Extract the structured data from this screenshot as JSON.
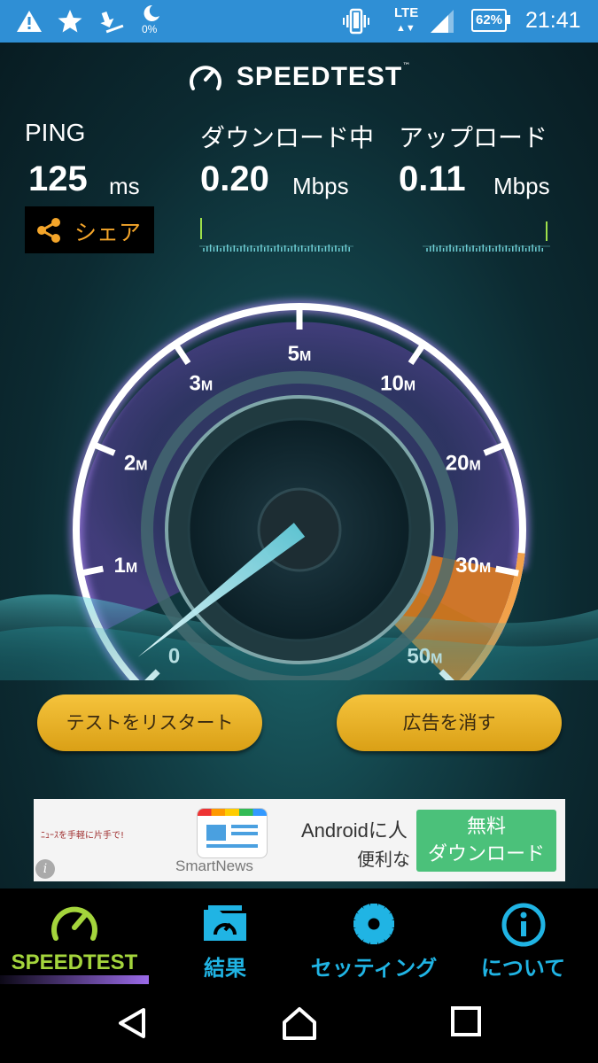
{
  "status_bar": {
    "battery_percent": "62%",
    "network": "LTE",
    "data_percent": "0%",
    "time": "21:41"
  },
  "header": {
    "title": "SPEEDTEST",
    "trademark": "™"
  },
  "ping": {
    "label": "PING",
    "value": "125",
    "unit": "ms"
  },
  "download": {
    "label": "ダウンロード中",
    "value": "0.20",
    "unit": "Mbps"
  },
  "upload": {
    "label": "アップロード",
    "value": "0.11",
    "unit": "Mbps"
  },
  "share_button": {
    "label": "シェア",
    "icon": "share-icon"
  },
  "gauge": {
    "scale_labels": [
      {
        "num": "0",
        "unit": ""
      },
      {
        "num": "1",
        "unit": "M"
      },
      {
        "num": "2",
        "unit": "M"
      },
      {
        "num": "3",
        "unit": "M"
      },
      {
        "num": "5",
        "unit": "M"
      },
      {
        "num": "10",
        "unit": "M"
      },
      {
        "num": "20",
        "unit": "M"
      },
      {
        "num": "30",
        "unit": "M"
      },
      {
        "num": "50",
        "unit": "M"
      }
    ],
    "needle_value_mbps": 0.2,
    "colors": {
      "ring": "#ffffff",
      "glow": "#9b7be0",
      "orange_zone": "#e8801c",
      "needle": "#bff3fb"
    }
  },
  "buttons": {
    "restart": "テストをリスタート",
    "remove_ads": "広告を消す"
  },
  "ad": {
    "left_text": "ﾆｭｰｽを手軽に片手で!",
    "brand": "SmartNews",
    "headline": "Androidに人",
    "subline": "便利な",
    "cta_line1": "無料",
    "cta_line2": "ダウンロード",
    "info_icon": "info-icon"
  },
  "tabs": [
    {
      "label": "SPEEDTEST",
      "icon": "speedometer-icon",
      "color": "#a4d53c",
      "active": true
    },
    {
      "label": "結果",
      "icon": "results-folder-icon",
      "color": "#20b4e4",
      "active": false
    },
    {
      "label": "セッティング",
      "icon": "gear-icon",
      "color": "#20b4e4",
      "active": false
    },
    {
      "label": "について",
      "icon": "info-icon",
      "color": "#20b4e4",
      "active": false
    }
  ],
  "nav": {
    "back": "back-icon",
    "home": "home-icon",
    "recents": "recents-icon"
  }
}
